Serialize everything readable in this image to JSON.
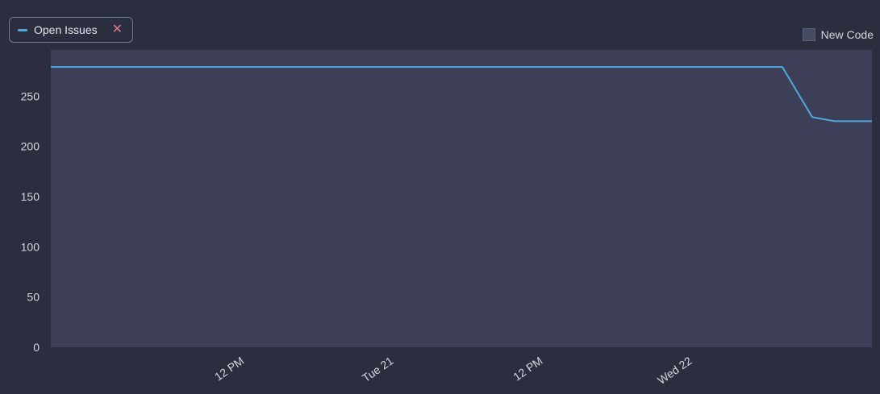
{
  "legend": {
    "series_label": "Open Issues",
    "close_glyph": "✕",
    "new_code_label": "New Code"
  },
  "colors": {
    "line": "#4fa8e0",
    "plot_bg": "#3d3f58",
    "page_bg": "#2a2e3e",
    "close": "#e07a8a"
  },
  "chart_data": {
    "type": "line",
    "x_axis": "time",
    "xlim": [
      0,
      55.0
    ],
    "x_ticks": [
      {
        "x": 13.0,
        "label": "12 PM"
      },
      {
        "x": 23.0,
        "label": "Tue 21"
      },
      {
        "x": 33.0,
        "label": "12 PM"
      },
      {
        "x": 43.0,
        "label": "Wed 22"
      }
    ],
    "ylim": [
      0,
      280
    ],
    "y_ticks": [
      0,
      50,
      100,
      150,
      200,
      250
    ],
    "series": [
      {
        "name": "Open Issues",
        "points": [
          {
            "x": 0,
            "y": 279
          },
          {
            "x": 49.0,
            "y": 279
          },
          {
            "x": 51.0,
            "y": 229
          },
          {
            "x": 52.5,
            "y": 225
          },
          {
            "x": 55.0,
            "y": 225
          }
        ]
      }
    ]
  }
}
